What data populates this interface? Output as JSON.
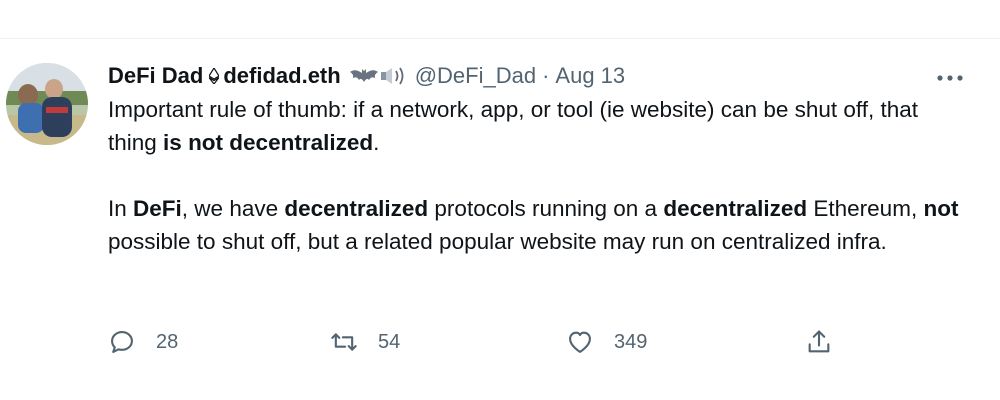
{
  "tweet": {
    "display_name": "DeFi Dad",
    "ens_name": "defidad.eth",
    "handle": "@DeFi_Dad",
    "separator": "·",
    "time": "Aug 13",
    "emojis": [
      "bat-emoji",
      "speaker-emoji"
    ],
    "paragraph1": {
      "part1": "Important rule of thumb: if a network, app, or tool (ie website) can be shut off, that thing ",
      "bold1": "is not decentralized",
      "part2": "."
    },
    "paragraph2": {
      "part1": "In ",
      "bold1": "DeFi",
      "part2": ", we have ",
      "bold2": "decentralized",
      "part3": " protocols running on a ",
      "bold3": "decentralized",
      "part4": " Ethereum, ",
      "bold4": "not",
      "part5": " possible to shut off, but a related popular website may run on centralized infra."
    },
    "actions": {
      "replies": "28",
      "retweets": "54",
      "likes": "349"
    }
  },
  "colors": {
    "text": "#0f1419",
    "secondary": "#536471",
    "divider": "#eff3f4"
  }
}
